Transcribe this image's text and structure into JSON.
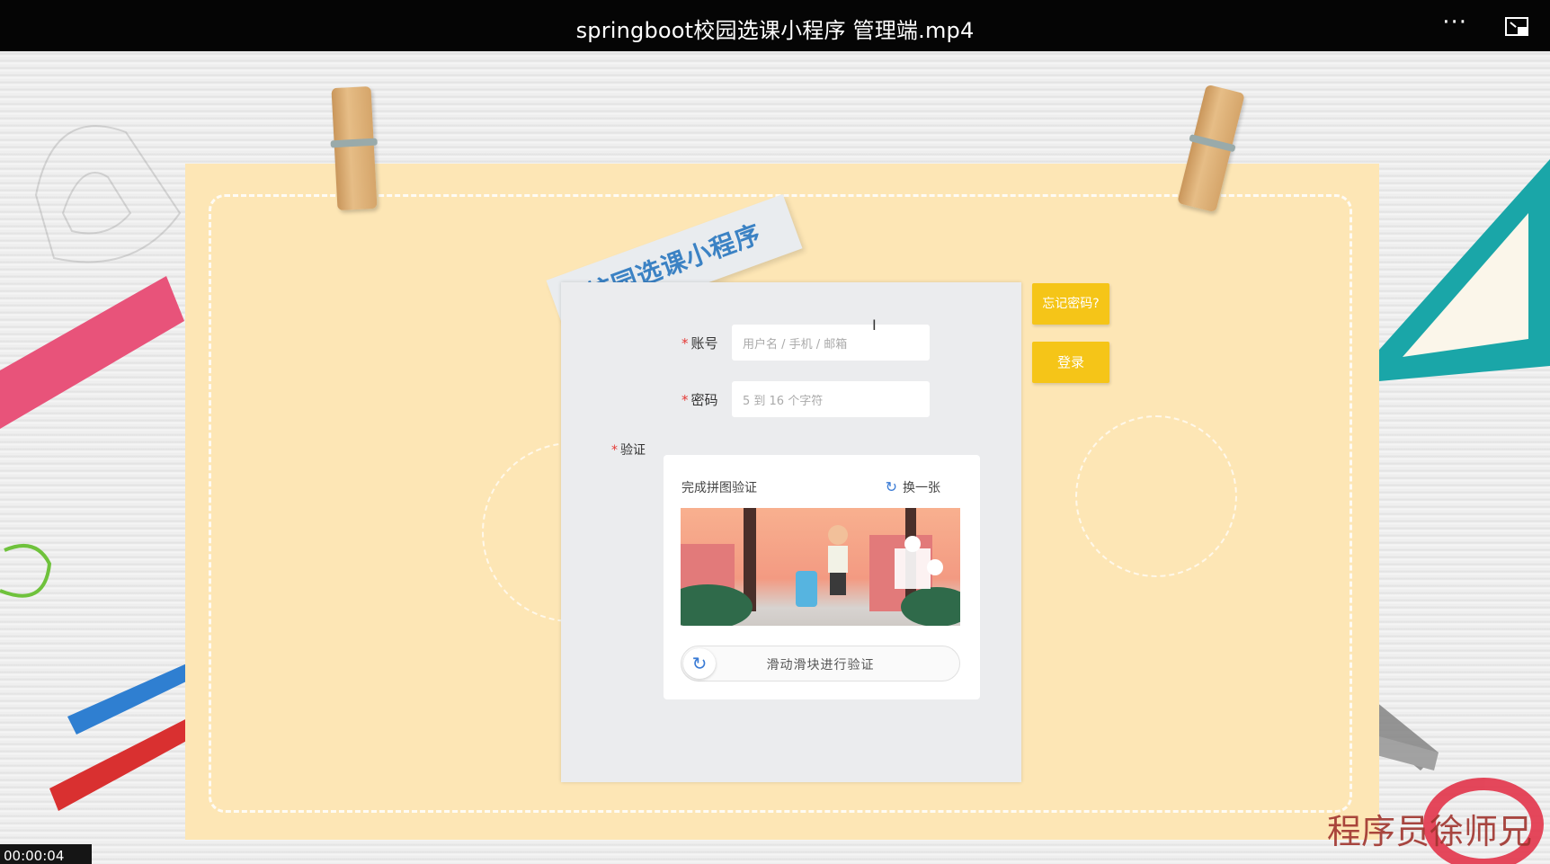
{
  "player": {
    "title": "springboot校园选课小程序 管理端.mp4",
    "more_icon": "more-icon",
    "pip_icon": "picture-in-picture-icon",
    "timecode": "00:00:04"
  },
  "app": {
    "banner_title": "校园选课小程序",
    "form": {
      "account_label": "账号",
      "account_placeholder": "用户名 / 手机 / 邮箱",
      "password_label": "密码",
      "password_placeholder": "5 到 16 个字符",
      "verify_label": "验证",
      "required_mark": "*"
    },
    "captcha": {
      "hint": "完成拼图验证",
      "refresh_label": "换一张",
      "slider_text": "滑动滑块进行验证"
    },
    "forgot_button": "忘记密码?",
    "login_button": "登录"
  },
  "watermark": "程序员徐师兄",
  "colors": {
    "accent_yellow": "#f5c518",
    "banner_text": "#3b82c4",
    "required_red": "#e53935",
    "paper": "#fde6b5"
  }
}
